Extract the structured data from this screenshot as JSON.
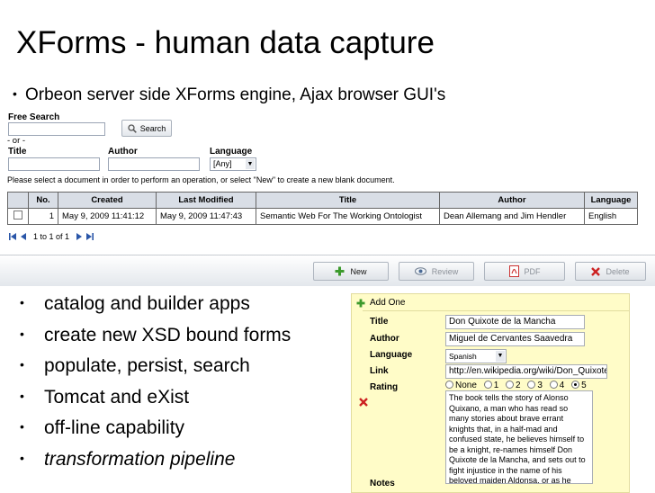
{
  "slide": {
    "title": "XForms - human data capture",
    "subtitle_bullet": "Orbeon server side XForms engine, Ajax browser GUI's"
  },
  "search": {
    "free_search_label": "Free Search",
    "search_button": "Search",
    "or_label": "- or -",
    "title_label": "Title",
    "author_label": "Author",
    "language_label": "Language",
    "language_value": "[Any]",
    "instructions": "Please select a document in order to perform an operation, or select \"New\" to create a new blank document."
  },
  "table": {
    "headers": [
      "No.",
      "Created",
      "Last Modified",
      "Title",
      "Author",
      "Language"
    ],
    "rows": [
      {
        "no": "1",
        "created": "May 9, 2009 11:41:12",
        "modified": "May 9, 2009 11:47:43",
        "title": "Semantic Web For The Working Ontologist",
        "author": "Dean Allemang and Jim Hendler",
        "language": "English"
      }
    ]
  },
  "pager": {
    "text": "1 to 1 of 1"
  },
  "toolbar": {
    "new": "New",
    "review": "Review",
    "pdf": "PDF",
    "delete": "Delete"
  },
  "bullets": [
    "catalog and builder apps",
    "create new XSD bound forms",
    "populate, persist, search",
    "Tomcat and eXist",
    "off-line capability"
  ],
  "bullet_italic": "transformation pipeline",
  "addone": {
    "header": "Add One",
    "title_label": "Title",
    "title_value": "Don Quixote de la Mancha",
    "author_label": "Author",
    "author_value": "Miguel de Cervantes Saavedra",
    "language_label": "Language",
    "language_value": "Spanish",
    "link_label": "Link",
    "link_value": "http://en.wikipedia.org/wiki/Don_Quixote",
    "rating_label": "Rating",
    "rating_options": [
      "None",
      "1",
      "2",
      "3",
      "4",
      "5"
    ],
    "rating_selected": "5",
    "notes_label": "Notes",
    "notes_value": "The book tells the story of Alonso Quixano, a man who has read so many stories about brave errant knights that, in a half-mad and confused state, he believes himself to be a knight, re-names himself Don Quixote de la Mancha, and sets out to fight injustice in the name of his beloved maiden Aldonsa, or as he knows her in his mind, Dulcinea del Toboso"
  },
  "colors": {
    "accent_green": "#3c9a2c",
    "delete_red": "#cc2222",
    "pager_blue": "#2a56a8",
    "form_bg": "#fffcc8"
  }
}
